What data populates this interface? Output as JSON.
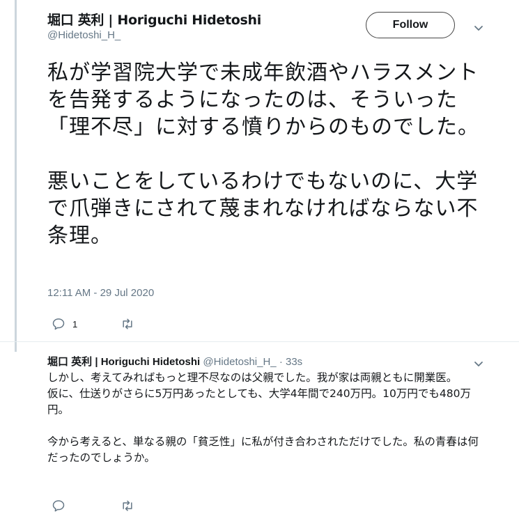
{
  "main_tweet": {
    "author_name": "堀口 英利 | Horiguchi Hidetoshi",
    "handle": "@Hidetoshi_H_",
    "follow_label": "Follow",
    "text": "私が学習院大学で未成年飲酒やハラスメントを告発するようになったのは、そういった「理不尽」に対する憤りからのものでした。\n\n悪いことをしているわけでもないのに、大学で爪弾きにされて蔑まれなければならない不条理。",
    "timestamp": "12:11 AM - 29 Jul 2020",
    "reply_count": "1",
    "icons": {
      "reply": "reply-icon",
      "retweet": "retweet-icon",
      "more": "chevron-down-icon"
    }
  },
  "reply_tweet": {
    "author_name": "堀口 英利 | Horiguchi Hidetoshi",
    "handle": "@Hidetoshi_H_",
    "separator": " · ",
    "time_ago": "33s",
    "text": "しかし、考えてみればもっと理不尽なのは父親でした。我が家は両親ともに開業医。\n仮に、仕送りがさらに5万円あったとしても、大学4年間で240万円。10万円でも480万円。\n\n今から考えると、単なる親の「貧乏性」に私が付き合わされただけでした。私の青春は何だったのでしょうか。"
  },
  "colors": {
    "text": "#14171a",
    "secondary": "#657786",
    "thread_line": "#ccd6dd",
    "border": "#444444"
  }
}
